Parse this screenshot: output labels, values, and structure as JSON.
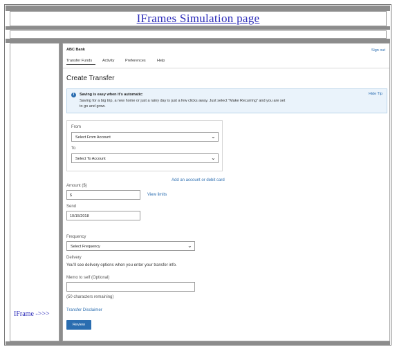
{
  "outer": {
    "title": "IFrames Simulation page",
    "iframe_label": "IFrame ->>>"
  },
  "bank": {
    "name": "ABC Bank",
    "sign_out": "Sign out"
  },
  "nav": {
    "items": [
      "Transfer Funds",
      "Activity",
      "Preferences",
      "Help"
    ]
  },
  "page_title": "Create Transfer",
  "tip": {
    "heading": "Saving is easy when it's automatic:",
    "body": "Saving for a big trip, a new home or just a rainy day is just a few clicks away. Just select \"Make Recurring\" and you are set to go and grow.",
    "hide_label": "Hide Tip",
    "icon": "info-icon"
  },
  "from": {
    "label": "From",
    "value": "Select From Account"
  },
  "to": {
    "label": "To",
    "value": "Select To Account"
  },
  "add_account_link": "Add an account or debit card",
  "amount": {
    "label": "Amount ($)",
    "value": "$",
    "view_limits": "View limits"
  },
  "send": {
    "label": "Send",
    "value": "10/15/2018"
  },
  "frequency": {
    "label": "Frequency",
    "value": "Select Frequency"
  },
  "delivery": {
    "label": "Delivery",
    "text": "You'll see delivery options when you enter your transfer info."
  },
  "memo": {
    "label": "Memo to self (Optional)",
    "value": "",
    "remaining": "(50 characters remaining)"
  },
  "disclaimer_link": "Transfer Disclaimer",
  "review_button": "Review",
  "colors": {
    "link": "#2a6db0",
    "button": "#2a6db0",
    "outer_link": "#2a2ab8",
    "frame_gray": "#8c8c8c"
  }
}
